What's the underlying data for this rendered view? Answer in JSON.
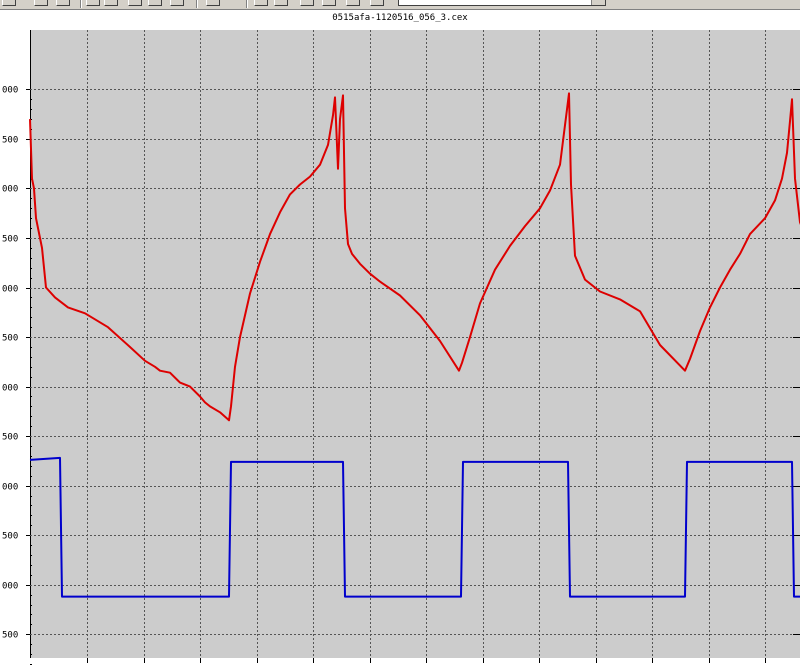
{
  "window": {
    "file_title": "0515afa-1120516_056_3.cex"
  },
  "toolbar": {
    "buttons": [
      "zoom-icon",
      "grid-icon",
      "cursor-icon",
      "graph-icon",
      "print-icon",
      "settings-icon"
    ],
    "dropdown_value": ""
  },
  "chart_data": {
    "type": "line",
    "title": "0515afa-1120516_056_3.cex",
    "xlabel": "",
    "ylabel": "",
    "grid": true,
    "background": "#cccccc",
    "ylim": [
      3.3,
      0.13
    ],
    "y_tick_labels": [
      "000",
      "500",
      "000",
      "500",
      "000",
      "500",
      "000",
      "500",
      "000",
      "500",
      "000",
      "500",
      "000"
    ],
    "y_tick_values": [
      3.0,
      2.75,
      2.5,
      2.25,
      2.0,
      1.75,
      1.5,
      1.25,
      1.0,
      0.75,
      0.5,
      0.25,
      0.0
    ],
    "series": [
      {
        "color": "#dd0000",
        "x": [
          0,
          2,
          4,
          6,
          8,
          10,
          12,
          16,
          25,
          38,
          55,
          78,
          100,
          115,
          125,
          130,
          140,
          150,
          160,
          170,
          175,
          180,
          190,
          199,
          201,
          205,
          210,
          220,
          230,
          240,
          250,
          260,
          270,
          280,
          290,
          298,
          303,
          305,
          308,
          310,
          313,
          315,
          318,
          322,
          330,
          340,
          350,
          370,
          390,
          410,
          429,
          432,
          440,
          450,
          465,
          480,
          495,
          510,
          520,
          530,
          536,
          539,
          541,
          545,
          555,
          570,
          590,
          610,
          630,
          655,
          660,
          670,
          680,
          690,
          700,
          710,
          720,
          735,
          745,
          752,
          757,
          760,
          762,
          765,
          770,
          780,
          790
        ],
        "y": [
          2.85,
          2.55,
          2.5,
          2.35,
          2.3,
          2.25,
          2.2,
          2.0,
          1.95,
          1.9,
          1.87,
          1.8,
          1.7,
          1.63,
          1.6,
          1.58,
          1.57,
          1.52,
          1.5,
          1.45,
          1.42,
          1.4,
          1.37,
          1.33,
          1.4,
          1.6,
          1.75,
          1.97,
          2.13,
          2.27,
          2.38,
          2.47,
          2.52,
          2.56,
          2.62,
          2.72,
          2.87,
          2.96,
          2.6,
          2.85,
          2.97,
          2.4,
          2.22,
          2.17,
          2.12,
          2.07,
          2.03,
          1.96,
          1.86,
          1.73,
          1.58,
          1.62,
          1.75,
          1.92,
          2.09,
          2.21,
          2.31,
          2.4,
          2.49,
          2.62,
          2.86,
          2.98,
          2.52,
          2.16,
          2.04,
          1.98,
          1.94,
          1.88,
          1.71,
          1.58,
          1.64,
          1.78,
          1.9,
          2.0,
          2.09,
          2.17,
          2.27,
          2.35,
          2.44,
          2.55,
          2.68,
          2.84,
          2.95,
          2.55,
          2.33,
          2.2,
          2.14
        ]
      },
      {
        "color": "#0000cc",
        "x": [
          0,
          30,
          32,
          199,
          201,
          313,
          315,
          431,
          433,
          538,
          540,
          655,
          657,
          762,
          764,
          790
        ],
        "y": [
          1.13,
          1.14,
          0.44,
          0.44,
          1.12,
          1.12,
          0.44,
          0.44,
          1.12,
          1.12,
          0.44,
          0.44,
          1.12,
          1.12,
          0.44,
          0.44
        ]
      }
    ]
  }
}
